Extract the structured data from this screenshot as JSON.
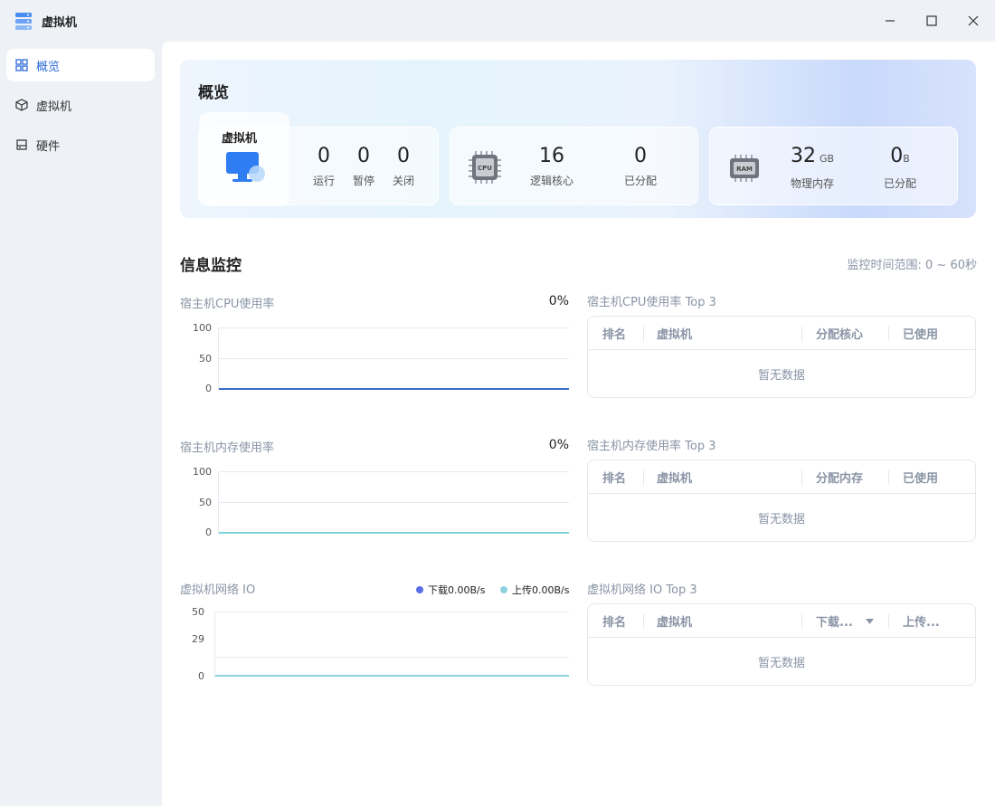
{
  "window": {
    "title": "虚拟机"
  },
  "sidebar": {
    "items": [
      {
        "label": "概览",
        "icon": "grid-icon",
        "active": true
      },
      {
        "label": "虚拟机",
        "icon": "cube-icon",
        "active": false
      },
      {
        "label": "硬件",
        "icon": "drive-icon",
        "active": false
      }
    ]
  },
  "overview": {
    "title": "概览",
    "vm": {
      "label": "虚拟机",
      "running": {
        "value": "0",
        "label": "运行"
      },
      "paused": {
        "value": "0",
        "label": "暂停"
      },
      "off": {
        "value": "0",
        "label": "关闭"
      }
    },
    "cpu": {
      "chip": "CPU",
      "cores": {
        "value": "16",
        "label": "逻辑核心"
      },
      "allocated": {
        "value": "0",
        "label": "已分配"
      }
    },
    "ram": {
      "chip": "RAM",
      "memory": {
        "value": "32",
        "unit": "GB",
        "label": "物理内存"
      },
      "allocated": {
        "value": "0",
        "unit": "B",
        "label": "已分配"
      }
    }
  },
  "monitor": {
    "title": "信息监控",
    "range": "监控时间范围: 0 ~ 60秒",
    "empty_text": "暂无数据",
    "cpu_chart": {
      "title": "宿主机CPU使用率",
      "value": "0%",
      "ticks": [
        "100",
        "50",
        "0"
      ]
    },
    "cpu_top": {
      "title": "宿主机CPU使用率 Top 3",
      "columns": [
        "排名",
        "虚拟机",
        "分配核心",
        "已使用"
      ]
    },
    "mem_chart": {
      "title": "宿主机内存使用率",
      "value": "0%",
      "ticks": [
        "100",
        "50",
        "0"
      ]
    },
    "mem_top": {
      "title": "宿主机内存使用率 Top 3",
      "columns": [
        "排名",
        "虚拟机",
        "分配内存",
        "已使用"
      ]
    },
    "net_chart": {
      "title": "虚拟机网络 IO",
      "ticks": [
        "50",
        "29",
        "0"
      ],
      "legend_download": "下载0.00B/s",
      "legend_upload": "上传0.00B/s"
    },
    "net_top": {
      "title": "虚拟机网络 IO Top 3",
      "columns": [
        "排名",
        "虚拟机",
        "下载...",
        "上传..."
      ]
    }
  },
  "colors": {
    "accent": "#2c6bd8",
    "cpu_line": "#3a6fc4",
    "mem_line": "#7fd3d8",
    "download": "#5b6ee8",
    "upload": "#8ed2e0"
  },
  "chart_data": [
    {
      "type": "line",
      "title": "宿主机CPU使用率",
      "ylim": [
        0,
        100
      ],
      "series": [
        {
          "values": [
            0,
            0
          ]
        }
      ]
    },
    {
      "type": "line",
      "title": "宿主机内存使用率",
      "ylim": [
        0,
        100
      ],
      "series": [
        {
          "values": [
            0,
            0
          ]
        }
      ]
    },
    {
      "type": "line",
      "title": "虚拟机网络 IO",
      "ylim": [
        0,
        50
      ],
      "series": [
        {
          "name": "下载0.00B/s",
          "values": [
            0,
            0
          ]
        },
        {
          "name": "上传0.00B/s",
          "values": [
            0,
            0
          ]
        }
      ]
    }
  ]
}
